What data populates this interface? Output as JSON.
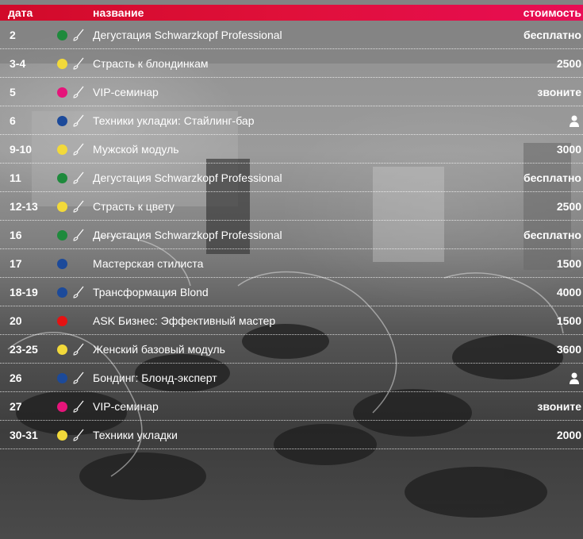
{
  "header": {
    "date": "дата",
    "name": "название",
    "price": "стоимость"
  },
  "colors": {
    "header_red": "#e0103a",
    "green": "#1e8a3c",
    "yellow": "#f2d93a",
    "pink": "#e6147a",
    "blue": "#1c4a9a",
    "red": "#e51212"
  },
  "rows": [
    {
      "date": "2",
      "dot": "green",
      "brush": true,
      "name": "Дегустация Schwarzkopf Professional",
      "price": "бесплатно"
    },
    {
      "date": "3-4",
      "dot": "yellow",
      "brush": true,
      "name": "Страсть к блондинкам",
      "price": "2500"
    },
    {
      "date": "5",
      "dot": "pink",
      "brush": true,
      "name": "VIP-семинар",
      "price": "звоните"
    },
    {
      "date": "6",
      "dot": "blue",
      "brush": true,
      "name": "Техники укладки: Стайлинг-бар",
      "price": "",
      "icon": "person-icon"
    },
    {
      "date": "9-10",
      "dot": "yellow",
      "brush": true,
      "name": "Мужской модуль",
      "price": "3000"
    },
    {
      "date": "11",
      "dot": "green",
      "brush": true,
      "name": "Дегустация Schwarzkopf Professional",
      "price": "бесплатно"
    },
    {
      "date": "12-13",
      "dot": "yellow",
      "brush": true,
      "name": "Страсть к цвету",
      "price": "2500"
    },
    {
      "date": "16",
      "dot": "green",
      "brush": true,
      "name": "Дегустация Schwarzkopf Professional",
      "price": "бесплатно"
    },
    {
      "date": "17",
      "dot": "blue",
      "brush": false,
      "name": "Мастерская стилиста",
      "price": "1500"
    },
    {
      "date": "18-19",
      "dot": "blue",
      "brush": true,
      "name": "Трансформация Blond",
      "price": "4000"
    },
    {
      "date": "20",
      "dot": "red",
      "brush": false,
      "name": "ASK Бизнес: Эффективный мастер",
      "price": "1500"
    },
    {
      "date": "23-25",
      "dot": "yellow",
      "brush": true,
      "name": "Женский базовый модуль",
      "price": "3600"
    },
    {
      "date": "26",
      "dot": "blue",
      "brush": true,
      "name": "Бондинг: Блонд-эксперт",
      "price": "",
      "icon": "person-icon"
    },
    {
      "date": "27",
      "dot": "pink",
      "brush": true,
      "name": "VIP-семинар",
      "price": "звоните"
    },
    {
      "date": "30-31",
      "dot": "yellow",
      "brush": true,
      "name": "Техники укладки",
      "price": "2000"
    }
  ]
}
